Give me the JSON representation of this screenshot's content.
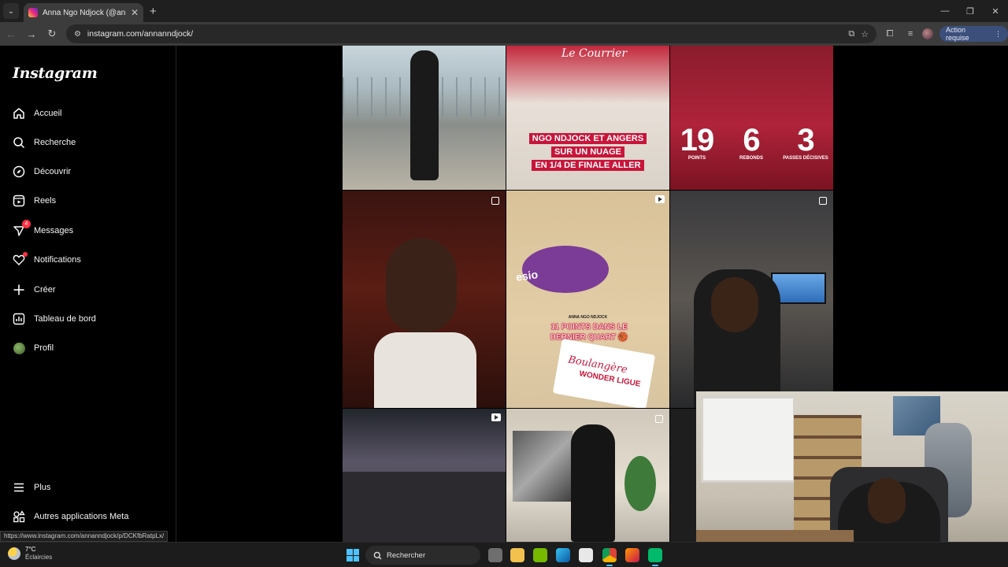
{
  "browser": {
    "tab_title": "Anna Ngo Ndjock (@annanndjock)",
    "address": "instagram.com/annanndjock/",
    "action_button": "Action requise",
    "hover_link": "https://www.instagram.com/annanndjock/p/DCKfbRatpLx/"
  },
  "sidebar": {
    "logo": "Instagram",
    "items": [
      {
        "label": "Accueil",
        "icon": "home-icon"
      },
      {
        "label": "Recherche",
        "icon": "search-icon"
      },
      {
        "label": "Découvrir",
        "icon": "compass-icon"
      },
      {
        "label": "Reels",
        "icon": "reels-icon"
      },
      {
        "label": "Messages",
        "icon": "messenger-icon",
        "badge": "4"
      },
      {
        "label": "Notifications",
        "icon": "heart-icon"
      },
      {
        "label": "Créer",
        "icon": "plus-icon"
      },
      {
        "label": "Tableau de bord",
        "icon": "dashboard-icon"
      },
      {
        "label": "Profil",
        "icon": "avatar"
      }
    ],
    "bottom_items": [
      {
        "label": "Plus",
        "icon": "menu-icon"
      },
      {
        "label": "Autres applications Meta",
        "icon": "meta-apps-icon"
      }
    ]
  },
  "posts": {
    "p2": {
      "brand": "Le Courrier",
      "headline_lines": [
        "NGO NDJOCK ET ANGERS",
        "SUR UN NUAGE",
        "EN 1/4 DE FINALE ALLER"
      ]
    },
    "p3": {
      "stats": [
        {
          "value": "19",
          "label": "POINTS"
        },
        {
          "value": "6",
          "label": "REBONDS"
        },
        {
          "value": "3",
          "label": "PASSES DÉCISIVES"
        }
      ]
    },
    "p5": {
      "court_text": "esio",
      "small_caption": "ANNA NGO NDJOCK",
      "caption_lines": [
        "11 POINTS DANS LE",
        "DERNIER QUART 🏀"
      ],
      "logo_main": "Boulangère",
      "logo_sub": "WONDER LIGUE"
    }
  },
  "taskbar": {
    "temperature": "7°C",
    "condition": "Éclaircies",
    "search_label": "Rechercher"
  }
}
